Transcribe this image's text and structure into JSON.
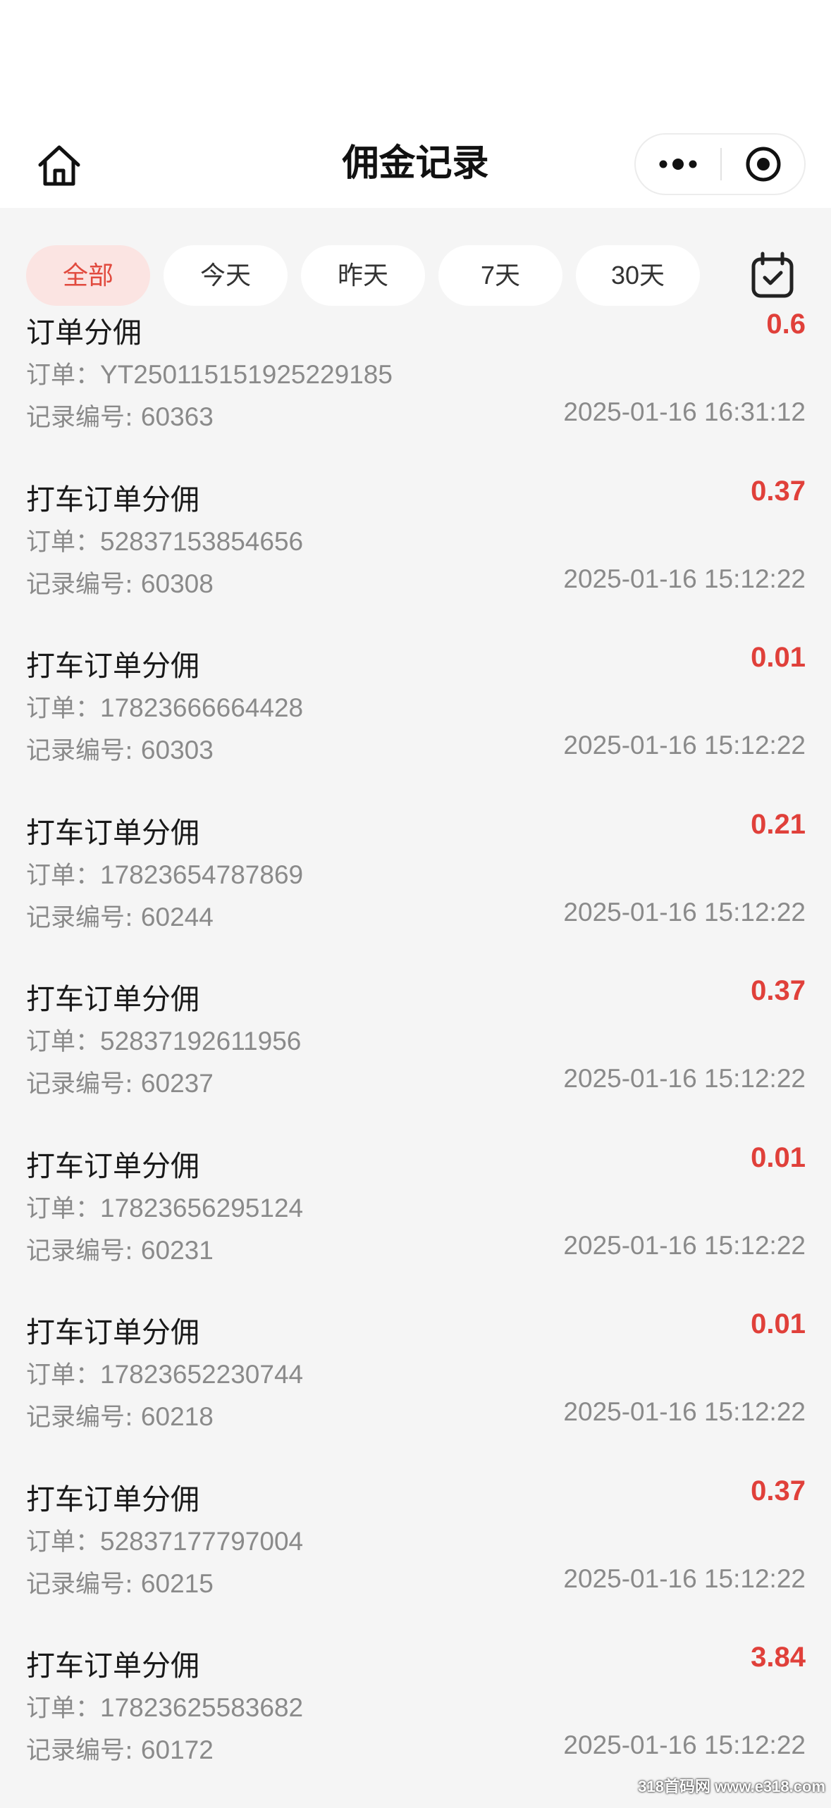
{
  "nav": {
    "title": "佣金记录"
  },
  "filters": [
    {
      "label": "全部",
      "active": true
    },
    {
      "label": "今天",
      "active": false
    },
    {
      "label": "昨天",
      "active": false
    },
    {
      "label": "7天",
      "active": false
    },
    {
      "label": "30天",
      "active": false
    }
  ],
  "order_prefix": "订单：",
  "record_id_prefix": "记录编号: ",
  "records": [
    {
      "title": "订单分佣",
      "amount": "0.6",
      "order": "YT25011515192522918​5",
      "record_id": "60363",
      "time": "2025-01-16 16:31:12"
    },
    {
      "title": "打车订单分佣",
      "amount": "0.37",
      "order": "52837153854656",
      "record_id": "60308",
      "time": "2025-01-16 15:12:22"
    },
    {
      "title": "打车订单分佣",
      "amount": "0.01",
      "order": "17823666664428",
      "record_id": "60303",
      "time": "2025-01-16 15:12:22"
    },
    {
      "title": "打车订单分佣",
      "amount": "0.21",
      "order": "17823654787869",
      "record_id": "60244",
      "time": "2025-01-16 15:12:22"
    },
    {
      "title": "打车订单分佣",
      "amount": "0.37",
      "order": "52837192611956",
      "record_id": "60237",
      "time": "2025-01-16 15:12:22"
    },
    {
      "title": "打车订单分佣",
      "amount": "0.01",
      "order": "17823656295124",
      "record_id": "60231",
      "time": "2025-01-16 15:12:22"
    },
    {
      "title": "打车订单分佣",
      "amount": "0.01",
      "order": "17823652230744",
      "record_id": "60218",
      "time": "2025-01-16 15:12:22"
    },
    {
      "title": "打车订单分佣",
      "amount": "0.37",
      "order": "52837177797004",
      "record_id": "60215",
      "time": "2025-01-16 15:12:22"
    },
    {
      "title": "打车订单分佣",
      "amount": "3.84",
      "order": "17823625583682",
      "record_id": "60172",
      "time": "2025-01-16 15:12:22"
    }
  ],
  "colors": {
    "accent": "#e0403a",
    "active_chip_bg": "#fbe4e2",
    "page_bg": "#f5f5f5"
  },
  "icons": {
    "home": "home-icon",
    "more": "more-dots-icon",
    "close": "target-circle-icon",
    "calendar": "calendar-check-icon"
  },
  "watermark": "318首码网 www.e318.com"
}
